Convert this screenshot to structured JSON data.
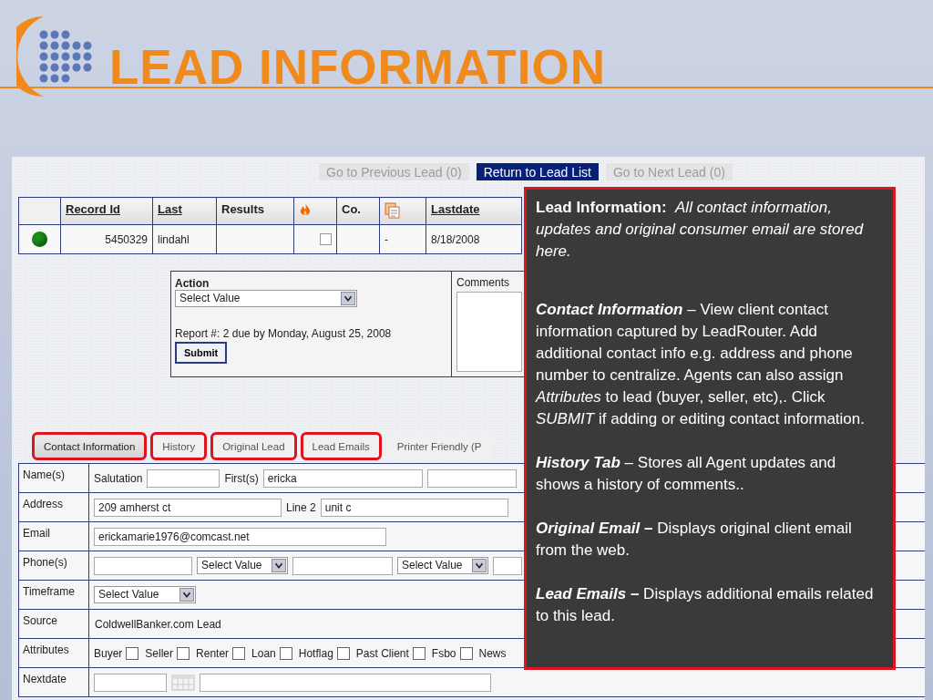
{
  "slide": {
    "title": "LEAD INFORMATION"
  },
  "nav": [
    {
      "label": "Go to Previous Lead (0)",
      "disabled": true
    },
    {
      "label": "Return to Lead List",
      "disabled": false
    },
    {
      "label": "Go to Next Lead (0)",
      "disabled": true
    }
  ],
  "table": {
    "columns": [
      {
        "kind": "blank"
      },
      {
        "kind": "text",
        "label": "Record Id",
        "sortable": true
      },
      {
        "kind": "text",
        "label": "Last",
        "sortable": true
      },
      {
        "kind": "text",
        "label": "Results",
        "sortable": false
      },
      {
        "kind": "icon"
      },
      {
        "kind": "text",
        "label": "Co.",
        "sortable": false
      },
      {
        "kind": "icon"
      },
      {
        "kind": "text",
        "label": "Lastdate",
        "sortable": true
      }
    ],
    "rows": [
      {
        "color": "#1c8c1c",
        "record_id": "5450329",
        "last": "lindahl",
        "hot": false,
        "column_7": "-",
        "lastdate": "8/18/2008"
      }
    ]
  },
  "action": {
    "label": "Action",
    "select": "Select Value",
    "report": "Report #: 2 due by Monday, August 25, 2008",
    "button": "Submit",
    "comments_label": "Comments"
  },
  "tabs": [
    {
      "label": "Contact Information",
      "selected": true,
      "outlined": true
    },
    {
      "label": "History",
      "selected": false,
      "outlined": true
    },
    {
      "label": "Original Lead",
      "selected": false,
      "outlined": true
    },
    {
      "label": "Lead Emails",
      "selected": false,
      "outlined": true
    },
    {
      "label": "Printer Friendly (P",
      "selected": false,
      "outlined": false
    }
  ],
  "form": [
    {
      "label": "Name(s)",
      "kind": "name",
      "fields": [
        {
          "kind": "input",
          "caption": "Salutation"
        },
        {
          "kind": "input",
          "caption": "First(s)",
          "value": "ericka"
        },
        {
          "kind": "input"
        }
      ]
    },
    {
      "label": "Address",
      "kind": "address",
      "fields": [
        {
          "kind": "input",
          "value": "209 amherst ct"
        },
        {
          "kind": "input",
          "caption": "Line 2",
          "value": "unit c"
        }
      ]
    },
    {
      "label": "Email",
      "kind": "email",
      "fields": [
        {
          "kind": "input",
          "value": "erickamarie1976@comcast.net"
        }
      ]
    },
    {
      "label": "Phone(s)",
      "kind": "phone",
      "fields": [
        {
          "kind": "input"
        },
        {
          "kind": "select",
          "value": "Select Value"
        },
        {
          "kind": "input"
        },
        {
          "kind": "select",
          "value": "Select Value"
        },
        {
          "kind": "input"
        }
      ]
    },
    {
      "label": "Timeframe",
      "kind": "select",
      "fields": [
        {
          "kind": "select",
          "value": "Select Value"
        }
      ]
    },
    {
      "label": "Source",
      "kind": "text",
      "fields": [
        {
          "kind": "text",
          "value": "ColdwellBanker.com Lead"
        }
      ]
    },
    {
      "label": "Attributes",
      "kind": "checks",
      "fields": [
        {
          "kind": "check",
          "caption": "Buyer",
          "checked": false
        },
        {
          "kind": "check",
          "caption": "Seller",
          "checked": false
        },
        {
          "kind": "check",
          "caption": "Renter",
          "checked": false
        },
        {
          "kind": "check",
          "caption": "Loan",
          "checked": false
        },
        {
          "kind": "check",
          "caption": "Hotflag",
          "checked": false
        },
        {
          "kind": "check",
          "caption": "Past Client",
          "checked": false
        },
        {
          "kind": "check",
          "caption": "Fsbo",
          "checked": false
        },
        {
          "kind": "text",
          "value": "News"
        }
      ]
    },
    {
      "label": "Nextdate",
      "kind": "date",
      "fields": [
        {
          "kind": "input"
        },
        {
          "kind": "calendar"
        },
        {
          "kind": "input"
        }
      ]
    }
  ],
  "callout": [
    {
      "kind": "intro",
      "lead": "Lead Information:",
      "text": "All contact information, updates and original consumer email are stored here."
    },
    {
      "kind": "topic",
      "lead": "Contact Information",
      "text": " – View client contact information captured by LeadRouter.  Add additional contact info e.g. address and phone number to centralize.  Agents can also assign *Attributes* to lead (buyer, seller, etc),. Click *SUBMIT* if adding or editing contact information."
    },
    {
      "kind": "topic",
      "lead": "History Tab",
      "text": " – Stores all Agent updates and shows a history of comments.."
    },
    {
      "kind": "topic",
      "lead": "Original Email –",
      "text": " Displays original client email from the web."
    },
    {
      "kind": "topic",
      "lead": "Lead Emails –",
      "text": " Displays additional emails related to this lead."
    }
  ]
}
